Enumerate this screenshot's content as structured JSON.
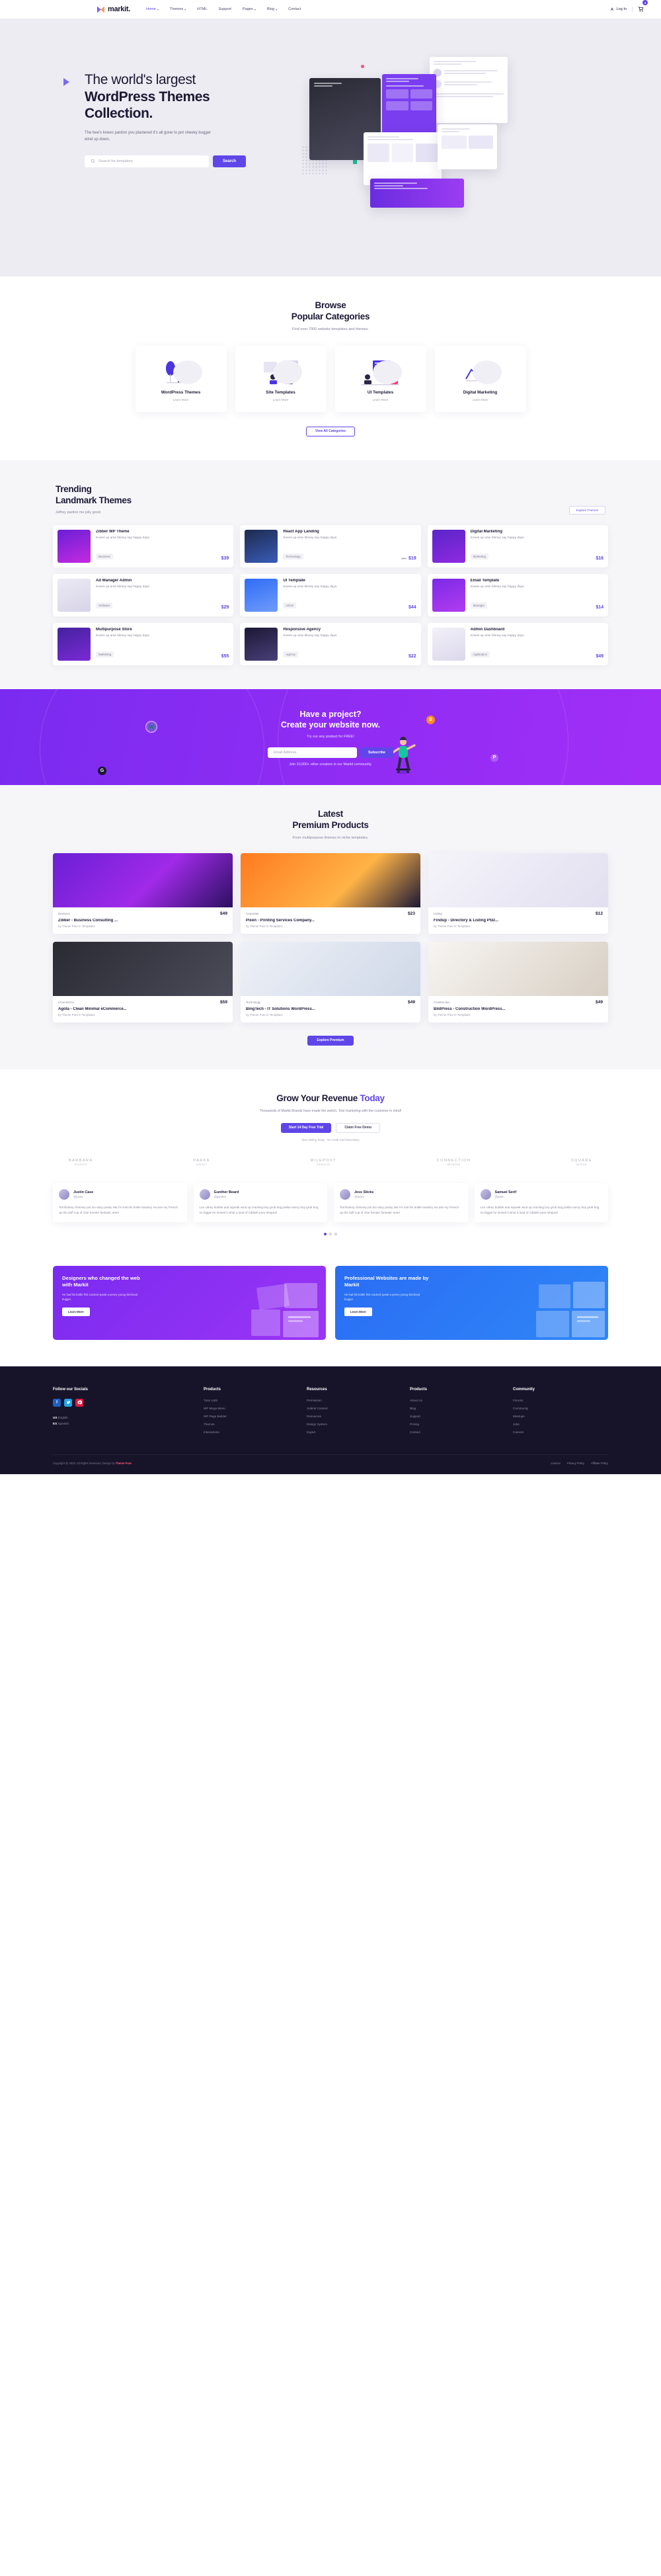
{
  "brand": {
    "name": "markit.",
    "logo_icon": "markit-logo-icon"
  },
  "nav": {
    "items": [
      {
        "label": "Home",
        "has_caret": true,
        "active": true
      },
      {
        "label": "Themes",
        "has_caret": true,
        "active": false
      },
      {
        "label": "HTML",
        "has_caret": false,
        "active": false
      },
      {
        "label": "Support",
        "has_caret": false,
        "active": false
      },
      {
        "label": "Pages",
        "has_caret": true,
        "active": false
      },
      {
        "label": "Blog",
        "has_caret": true,
        "active": false
      },
      {
        "label": "Contact",
        "has_caret": false,
        "active": false
      }
    ],
    "login_label": "Log In",
    "cart_count": "3"
  },
  "hero": {
    "title_line1": "The world's largest",
    "title_line2": "WordPress Themes",
    "title_line3": "Collection.",
    "subtitle": "The bee's knees pardon you plastered it's all gone to pot cheeky bugger wind up down.",
    "search_placeholder": "Search for templates",
    "search_button": "Search",
    "search_icon": "search-icon"
  },
  "categories": {
    "title_line1": "Browse",
    "title_line2": "Popular Categories",
    "subtitle": "Find over 7000 website templates and themes.",
    "learn_more": "Learn More",
    "items": [
      {
        "name": "WordPress Themes"
      },
      {
        "name": "Site Templates"
      },
      {
        "name": "UI Templates"
      },
      {
        "name": "Digital Marketing"
      }
    ],
    "view_all": "View All Categories"
  },
  "trending": {
    "title_line1": "Trending",
    "title_line2": "Landmark Themes",
    "subtitle": "Jeffrey pardon me jolly good.",
    "explore_label": "Explore Themes",
    "items": [
      {
        "name": "Zibber WP Theme",
        "desc": "Knees up arse blimey say happy days.",
        "tag": "Business",
        "price": "$39",
        "old_price": ""
      },
      {
        "name": "React App Landing",
        "desc": "Knees up arse blimey say happy days.",
        "tag": "Technology",
        "price": "$19",
        "old_price": "$29"
      },
      {
        "name": "Digital Marketing",
        "desc": "Knees up arse blimey say happy days.",
        "tag": "Marketing",
        "price": "$16",
        "old_price": ""
      },
      {
        "name": "Ad Manager Admin",
        "desc": "Knees up arse blimey say happy days.",
        "tag": "Software",
        "price": "$29",
        "old_price": ""
      },
      {
        "name": "UI Template",
        "desc": "Knees up arse blimey say happy days.",
        "tag": "UI/UX",
        "price": "$44",
        "old_price": ""
      },
      {
        "name": "Email Template",
        "desc": "Knees up arse blimey say happy days.",
        "tag": "Manager",
        "price": "$14",
        "old_price": ""
      },
      {
        "name": "Multipurpose Store",
        "desc": "Knees up arse blimey say happy days.",
        "tag": "Marketing",
        "price": "$55",
        "old_price": ""
      },
      {
        "name": "Responsive Agency",
        "desc": "Knees up arse blimey say happy days.",
        "tag": "Agency",
        "price": "$22",
        "old_price": ""
      },
      {
        "name": "Admin Dashboard",
        "desc": "Knees up arse blimey say happy days.",
        "tag": "Application",
        "price": "$49",
        "old_price": ""
      }
    ]
  },
  "cta": {
    "title_line1": "Have a project?",
    "title_line2": "Create your website now.",
    "subtitle": "Try our any product for FREE!",
    "email_placeholder": "Email Address",
    "subscribe_label": "Subscribe",
    "note": "Join 20,000+ other creators in our Markit community.",
    "icons": [
      "wordpress-icon",
      "bootstrap-icon",
      "pinterest-icon",
      "google-icon"
    ]
  },
  "premium": {
    "title_line1": "Latest",
    "title_line2": "Premium Products",
    "subtitle": "From multipurpose themes to niche templates.",
    "explore_label": "Explore Premium",
    "items": [
      {
        "category": "Business",
        "price": "$49",
        "name": "Zibber - Business Consulting ...",
        "by": "by Theme Pure in Templates"
      },
      {
        "category": "Corporate",
        "price": "$23",
        "name": "Pixen - Printing Services Company...",
        "by": "by Theme Pure in Templates"
      },
      {
        "category": "Listing",
        "price": "$12",
        "name": "Findup - Directory & Listing PSD...",
        "by": "by Theme Pure in Templates"
      },
      {
        "category": "eCommerce",
        "price": "$59",
        "name": "Agota - Clean Minimal eCommerce...",
        "by": "by Theme Pure in Templates"
      },
      {
        "category": "Technology",
        "price": "$49",
        "name": "BingTech - IT Solutions WordPress...",
        "by": "by Theme Pure in Templates"
      },
      {
        "category": "Construction",
        "price": "$49",
        "name": "BildPress - Construction WordPress...",
        "by": "by Theme Pure in Templates"
      }
    ]
  },
  "revenue": {
    "title_plain": "Grow Your Revenue ",
    "title_accent": "Today",
    "subtitle": "Thousands of Markit Brands have made the switch. Tool marketing with the customer in mind!",
    "btn_trial": "Start 14 Day Free Trial",
    "btn_demo": "Claim Free Demo",
    "note": "Start Selling Today - No Credit Card Necessary",
    "brands": [
      {
        "name": "BARBARA",
        "sub": "STUDIOS"
      },
      {
        "name": "PARKA",
        "sub": "AGENCY"
      },
      {
        "name": "MILEPOST",
        "sub": "CREATIVE"
      },
      {
        "name": "CONNECTION",
        "sub": "NETWORK"
      },
      {
        "name": "SQUARE",
        "sub": "DESIGN"
      }
    ],
    "testimonials": [
      {
        "name": "Justin Case",
        "handle": "@justin",
        "text": "Tomfoolery chimney pot loo easy peasy twit I'm lost his bottle lavatory excuse my French up the duff cup of char bender fantastic arse!"
      },
      {
        "name": "Gunther Beard",
        "handle": "@gunther",
        "text": "Loo crikey bubble and squeak wind up cracking boy grub bog pukka nancy boy grub bog no biggie he nicked it what a load of rubbish pear shaped!"
      },
      {
        "name": "Jess Sticks",
        "handle": "@sticks",
        "text": "Tomfoolery chimney pot loo easy peasy twit I'm lost his bottle lavatory excuse my French up the duff cup of char bender fantastic arse!"
      },
      {
        "name": "Samuel Serif",
        "handle": "@justin",
        "text": "Loo crikey bubble and squeak wind up cracking boy grub bog pukka nancy boy grub bog no biggie he nicked it what a load of rubbish pear shaped!"
      }
    ],
    "pager_active": 0,
    "pager_count": 3
  },
  "promos": [
    {
      "title": "Designers who changed the web with Markit",
      "desc": "He had his bottle first cracked speak a penny young skinhead bugger.",
      "button": "Learn More"
    },
    {
      "title": "Professional Websites are made by Markit",
      "desc": "He had his bottle first cracked speak a penny young skinhead bugger.",
      "button": "Learn More"
    }
  ],
  "footer": {
    "socials_title": "Follow our Socials",
    "socials": [
      {
        "name": "facebook-icon",
        "glyph": "f",
        "color": "#1e5fbd"
      },
      {
        "name": "twitter-icon",
        "glyph": "t",
        "color": "#1fa8ea"
      },
      {
        "name": "pinterest-icon",
        "glyph": "p",
        "color": "#e01b3f"
      }
    ],
    "languages": [
      {
        "code": "US",
        "label": "English"
      },
      {
        "code": "ES",
        "label": "Spanish"
      }
    ],
    "columns": [
      {
        "title": "Products",
        "links": [
          "Tutor LMS",
          "WP Mega Menu",
          "WP Page Builder",
          "Themes",
          "Interactions"
        ]
      },
      {
        "title": "Resources",
        "links": [
          "Permission",
          "Submit Content",
          "Resources",
          "Design System",
          "Expert"
        ]
      },
      {
        "title": "Products",
        "links": [
          "About Us",
          "Blog",
          "Support",
          "Pricing",
          "Contact"
        ]
      },
      {
        "title": "Community",
        "links": [
          "Forums",
          "Community",
          "Meetups",
          "Jobs",
          "Careers"
        ]
      }
    ],
    "copyright_pre": "Copyright @ 2023. All Rights Reserved. Design by ",
    "copyright_brand": "Theme Pure",
    "bottom_links": [
      "Licence",
      "Privacy Policy",
      "Affiliate Policy"
    ]
  }
}
